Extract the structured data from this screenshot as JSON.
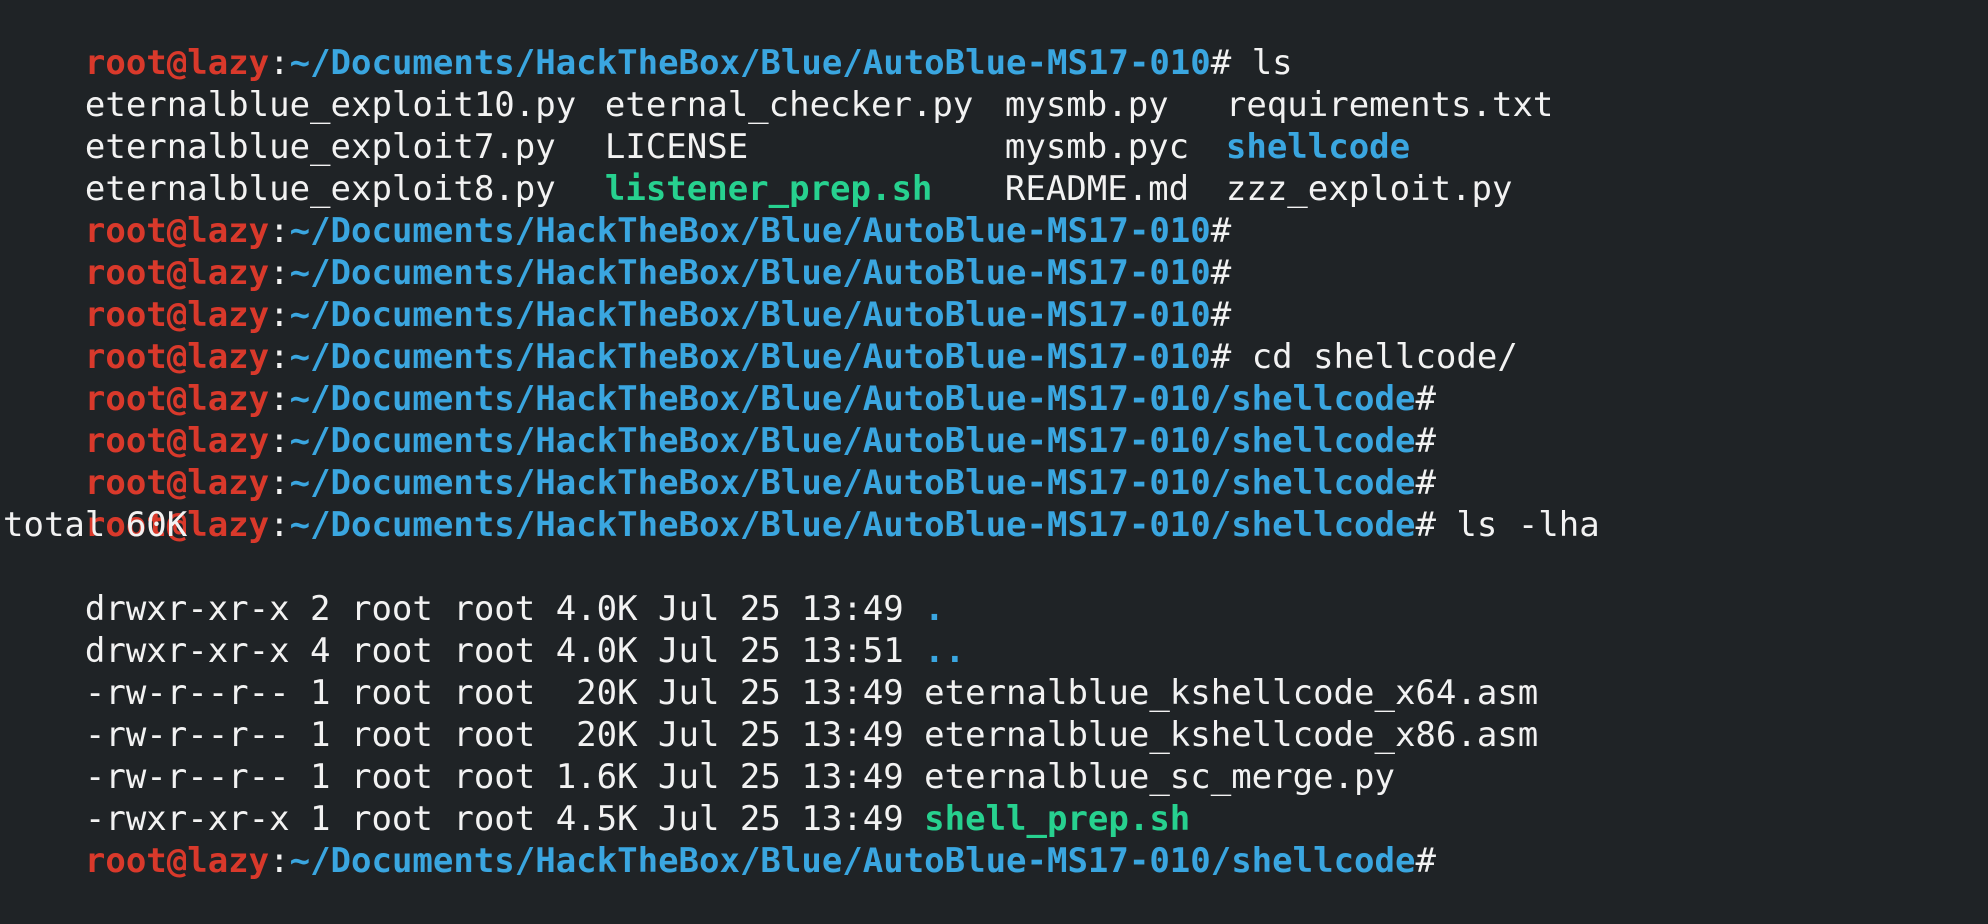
{
  "colors": {
    "background": "#1f2326",
    "text": "#f2f2f2",
    "user": "#d9392b",
    "path": "#3aa6e0",
    "executable": "#27d18f"
  },
  "prompt": {
    "user": "root@lazy",
    "colon": ":",
    "path": "~/Documents/HackTheBox/Blue/AutoBlue-MS17-010",
    "path_sub": "~/Documents/HackTheBox/Blue/AutoBlue-MS17-010/shellcode",
    "hash": "#"
  },
  "commands": {
    "ls": " ls",
    "cd": " cd shellcode/",
    "ls_lha": " ls -lha"
  },
  "ls_rows": [
    [
      "eternalblue_exploit10.py",
      "eternal_checker.py",
      "mysmb.py",
      "requirements.txt"
    ],
    [
      "eternalblue_exploit7.py",
      "LICENSE",
      "mysmb.pyc",
      "shellcode"
    ],
    [
      "eternalblue_exploit8.py",
      "listener_prep.sh",
      "README.md",
      "zzz_exploit.py"
    ]
  ],
  "ls_lha": {
    "total": "total 60K",
    "rows": [
      {
        "meta": "drwxr-xr-x 2 root root 4.0K Jul 25 13:49 ",
        "name": "."
      },
      {
        "meta": "drwxr-xr-x 4 root root 4.0K Jul 25 13:51 ",
        "name": ".."
      },
      {
        "meta": "-rw-r--r-- 1 root root  20K Jul 25 13:49 ",
        "name": "eternalblue_kshellcode_x64.asm"
      },
      {
        "meta": "-rw-r--r-- 1 root root  20K Jul 25 13:49 ",
        "name": "eternalblue_kshellcode_x86.asm"
      },
      {
        "meta": "-rw-r--r-- 1 root root 1.6K Jul 25 13:49 ",
        "name": "eternalblue_sc_merge.py"
      },
      {
        "meta": "-rwxr-xr-x 1 root root 4.5K Jul 25 13:49 ",
        "name": "shell_prep.sh"
      }
    ]
  }
}
